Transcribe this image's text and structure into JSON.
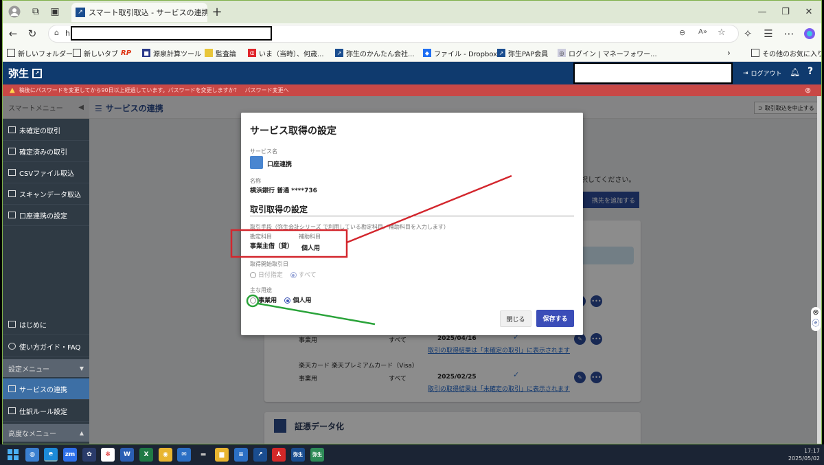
{
  "browser": {
    "tab_title": "スマート取引取込 - サービスの連携",
    "url_prefix": "h",
    "bookmarks": [
      {
        "label": "新しいフォルダー"
      },
      {
        "label": "新しいタブ"
      },
      {
        "label": "RP"
      },
      {
        "label": "源泉計算ツール"
      },
      {
        "label": "監査論"
      },
      {
        "label": "いま（当時）、何歳..."
      },
      {
        "label": "弥生のかんたん会社..."
      },
      {
        "label": "ファイル - Dropbox"
      },
      {
        "label": "弥生PAP会員"
      },
      {
        "label": "ログイン | マネーフォワー..."
      }
    ],
    "other_favorites": "その他のお気に入り"
  },
  "app": {
    "logo": "弥生",
    "logout": "ログアウト",
    "warning": "稿後にパスワードを変更してから90日以上経過しています。パスワードを変更しますか？　パスワード変更へ"
  },
  "sidebar": {
    "smart_menu": "スマートメニュー",
    "items": [
      {
        "label": "未確定の取引"
      },
      {
        "label": "確定済みの取引"
      },
      {
        "label": "CSVファイル取込"
      },
      {
        "label": "スキャンデータ取込"
      },
      {
        "label": "口座連携の設定"
      }
    ],
    "bottom_items": [
      {
        "label": "はじめに"
      },
      {
        "label": "使い方ガイド・FAQ"
      }
    ],
    "settings_menu": "設定メニュー",
    "settings_items": [
      {
        "label": "サービスの連携"
      },
      {
        "label": "仕訳ルール設定"
      }
    ],
    "advanced_menu": "高度なメニュー"
  },
  "main": {
    "title": "サービスの連携",
    "cancel_import": "取引取込を中止する",
    "hint_text": "択してください。",
    "add_button": "携先を追加する",
    "rows": [
      {
        "usage": "事業用",
        "range": "すべて",
        "date": "2025/04/16",
        "link": "取引の取得結果は「未確定の取引」に表示されます"
      },
      {
        "name": "楽天カード 楽天プレミアムカード（Visa）",
        "usage": "事業用",
        "range": "すべて",
        "date": "2025/02/25",
        "link": "取引の取得結果は「未確定の取引」に表示されます"
      }
    ],
    "section2_title": "証憑データ化"
  },
  "modal": {
    "title": "サービス取得の設定",
    "service_label": "サービス名",
    "service_value": "口座連携",
    "name_label": "名称",
    "name_value": "横浜銀行 普通 ****736",
    "section_title": "取引取得の設定",
    "method_label": "取引手段（弥生会計シリーズ で利用している勘定科目／補助科目を入力します）",
    "account_label": "勘定科目",
    "account_value": "事業主借（貸）",
    "sub_label": "補助科目",
    "sub_value": "個人用",
    "start_label": "取得開始取引日",
    "start_opt1": "日付指定",
    "start_opt2": "すべて",
    "usage_label": "主な用途",
    "usage_opt1": "事業用",
    "usage_opt2": "個人用",
    "close_button": "閉じる",
    "save_button": "保存する"
  },
  "taskbar": {
    "time": "17:17",
    "date": "2025/05/02"
  },
  "colors": {
    "header_navy": "#0f3a6e",
    "warning_red": "#c94846",
    "save_blue": "#3b4db8",
    "annotation_red": "#d3262d",
    "annotation_green": "#2aa33a"
  }
}
